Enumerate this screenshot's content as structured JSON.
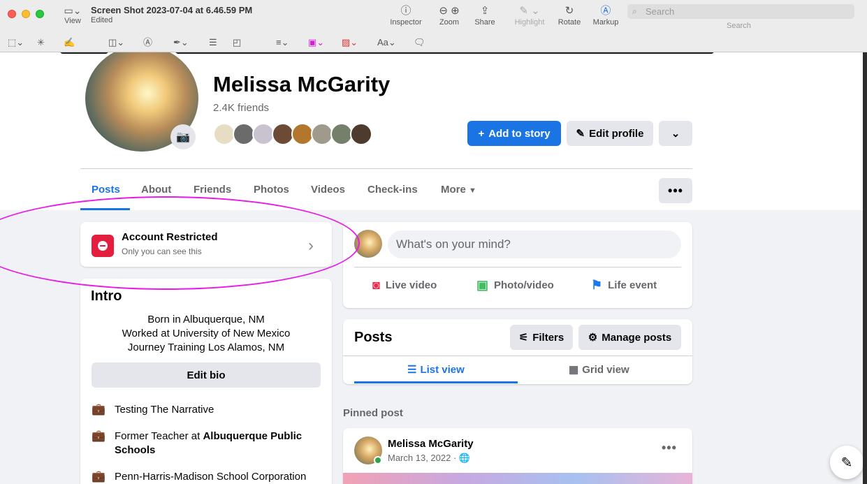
{
  "window": {
    "title": "Screen Shot 2023-07-04 at 6.46.59 PM",
    "subtitle": "Edited",
    "view_label": "View",
    "toolbar": {
      "inspector": "Inspector",
      "zoom": "Zoom",
      "share": "Share",
      "highlight": "Highlight",
      "rotate": "Rotate",
      "markup": "Markup"
    },
    "search_placeholder": "Search",
    "search_label": "Search",
    "font_button": "Aa"
  },
  "profile": {
    "name": "Melissa McGarity",
    "friends_count": "2.4K friends",
    "add_story": "Add to story",
    "edit_profile": "Edit profile"
  },
  "tabs": {
    "posts": "Posts",
    "about": "About",
    "friends": "Friends",
    "photos": "Photos",
    "videos": "Videos",
    "checkins": "Check-ins",
    "more": "More"
  },
  "restricted": {
    "title": "Account Restricted",
    "subtitle": "Only you can see this"
  },
  "intro": {
    "title": "Intro",
    "bio": [
      "Born in Albuquerque, NM",
      "Worked at University of New Mexico",
      "Journey Training Los Alamos, NM"
    ],
    "edit_bio": "Edit bio",
    "item1": "Testing The Narrative",
    "item2_prefix": "Former Teacher at ",
    "item2_bold": "Albuquerque Public Schools",
    "item3": "Penn-Harris-Madison School Corporation"
  },
  "composer": {
    "placeholder": "What's on your mind?",
    "live": "Live video",
    "photo": "Photo/video",
    "life": "Life event"
  },
  "posts_card": {
    "title": "Posts",
    "filters": "Filters",
    "manage": "Manage posts",
    "list_view": "List view",
    "grid_view": "Grid view"
  },
  "pinned": {
    "label": "Pinned post",
    "author": "Melissa McGarity",
    "date": "March 13, 2022 · "
  },
  "colors": {
    "facebook_blue": "#1b74e4",
    "annotation_ellipse": "#e91ae9",
    "restricted_red": "#e41e3f"
  }
}
